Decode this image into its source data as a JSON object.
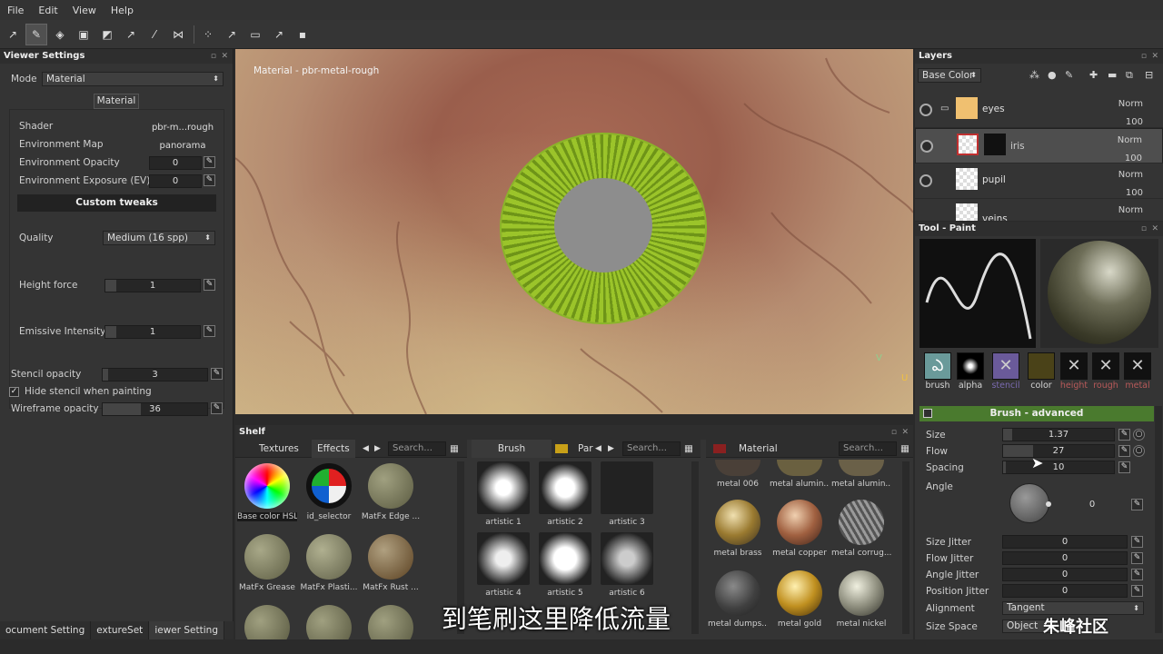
{
  "menu": [
    "File",
    "Edit",
    "View",
    "Help"
  ],
  "toolbar": {
    "icons": [
      "paint-brush-icon",
      "eraser-icon",
      "projection-icon",
      "polyfill-icon",
      "smudge-icon",
      "clone-icon",
      "picker-icon",
      "symmetry-icon",
      "layout-icon",
      "2d-view-icon",
      "camera-icon"
    ]
  },
  "viewer_settings": {
    "title": "Viewer Settings",
    "mode_label": "Mode",
    "mode_value": "Material",
    "material_button": "Material",
    "shader_label": "Shader",
    "shader_value": "pbr-m...rough",
    "env_map_label": "Environment Map",
    "env_map_value": "panorama",
    "env_opacity_label": "Environment Opacity",
    "env_opacity_value": "0",
    "env_exposure_label": "Environment Exposure (EV)",
    "env_exposure_value": "0",
    "custom_tweaks": "Custom tweaks",
    "quality_label": "Quality",
    "quality_value": "Medium (16 spp)",
    "height_force_label": "Height force",
    "height_force_value": "1",
    "emissive_label": "Emissive Intensity",
    "emissive_value": "1",
    "stencil_opacity_label": "Stencil opacity",
    "stencil_opacity_value": "3",
    "hide_stencil_label": "Hide stencil when painting",
    "hide_stencil_checked": true,
    "wireframe_opacity_label": "Wireframe opacity",
    "wireframe_opacity_value": "36"
  },
  "left_tabs": [
    "ocument Setting",
    "extureSet",
    "iewer Setting"
  ],
  "viewport": {
    "title": "Material - pbr-metal-rough",
    "gizmo_v": "V",
    "gizmo_u": "U"
  },
  "shelf": {
    "title": "Shelf",
    "panel1": {
      "tabs": [
        "Textures",
        "Effects"
      ],
      "search": "Search...",
      "items": [
        {
          "label": "Base color HSL",
          "color": "#conic"
        },
        {
          "label": "id_selector",
          "color": "#idsel"
        },
        {
          "label": "MatFx Edge ...",
          "color": "#8a8a6a"
        },
        {
          "label": "MatFx Grease",
          "color": "#8a8a6a"
        },
        {
          "label": "MatFx Plasti...",
          "color": "#8f8f73"
        },
        {
          "label": "MatFx Rust ...",
          "color": "#7d6a4a"
        }
      ]
    },
    "panel2": {
      "tabs": [
        "Brush",
        "Par"
      ],
      "search": "Search...",
      "items": [
        "artistic 1",
        "artistic 2",
        "artistic 3",
        "artistic 4",
        "artistic 5",
        "artistic 6"
      ]
    },
    "panel3": {
      "tab": "Material",
      "search": "Search...",
      "items": [
        "metal 006",
        "metal alumin...",
        "metal alumin...",
        "metal brass",
        "metal copper",
        "metal corrug...",
        "metal dumps...",
        "metal gold",
        "metal nickel"
      ]
    }
  },
  "layers": {
    "title": "Layers",
    "channel": "Base Color",
    "rows": [
      {
        "name": "eyes",
        "blend": "Norm",
        "opacity": "100"
      },
      {
        "name": "iris",
        "blend": "Norm",
        "opacity": "100"
      },
      {
        "name": "pupil",
        "blend": "Norm",
        "opacity": "100"
      },
      {
        "name": "veins",
        "blend": "Norm",
        "opacity": ""
      }
    ]
  },
  "tool": {
    "title": "Tool - Paint",
    "channels": [
      {
        "label": "brush",
        "active": true
      },
      {
        "label": "alpha",
        "active": true
      },
      {
        "label": "stencil",
        "active": false
      },
      {
        "label": "color",
        "active": true
      },
      {
        "label": "height",
        "active": false
      },
      {
        "label": "rough",
        "active": false
      },
      {
        "label": "metal",
        "active": false
      }
    ],
    "section": "Brush - advanced",
    "size_label": "Size",
    "size_value": "1.37",
    "flow_label": "Flow",
    "flow_value": "27",
    "spacing_label": "Spacing",
    "spacing_value": "10",
    "angle_label": "Angle",
    "angle_value": "0",
    "size_jitter_label": "Size Jitter",
    "size_jitter_value": "0",
    "flow_jitter_label": "Flow Jitter",
    "flow_jitter_value": "0",
    "angle_jitter_label": "Angle Jitter",
    "angle_jitter_value": "0",
    "position_jitter_label": "Position Jitter",
    "position_jitter_value": "0",
    "alignment_label": "Alignment",
    "alignment_value": "Tangent",
    "size_space_label": "Size Space",
    "size_space_value": "Object"
  },
  "subtitle": "到笔刷这里降低流量",
  "watermark": "朱峰社区"
}
